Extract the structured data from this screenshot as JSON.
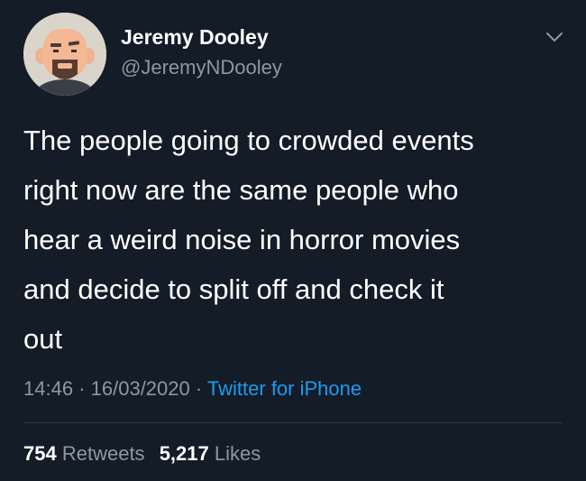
{
  "user": {
    "display_name": "Jeremy Dooley",
    "handle": "@JeremyNDooley"
  },
  "tweet": {
    "text": "The people going to crowded events\nright now are the same people who\nhear a weird noise in horror movies\nand decide to split off and check it\nout",
    "time": "14:46",
    "date": "16/03/2020",
    "separator": "·",
    "source": "Twitter for iPhone"
  },
  "stats": {
    "retweets_count": "754",
    "retweets_label": "Retweets",
    "likes_count": "5,217",
    "likes_label": "Likes"
  },
  "colors": {
    "background": "#131c27",
    "text": "#ffffff",
    "secondary": "#8b98a5",
    "link": "#1d9bf0"
  },
  "icons": {
    "more": "chevron-down-icon"
  }
}
